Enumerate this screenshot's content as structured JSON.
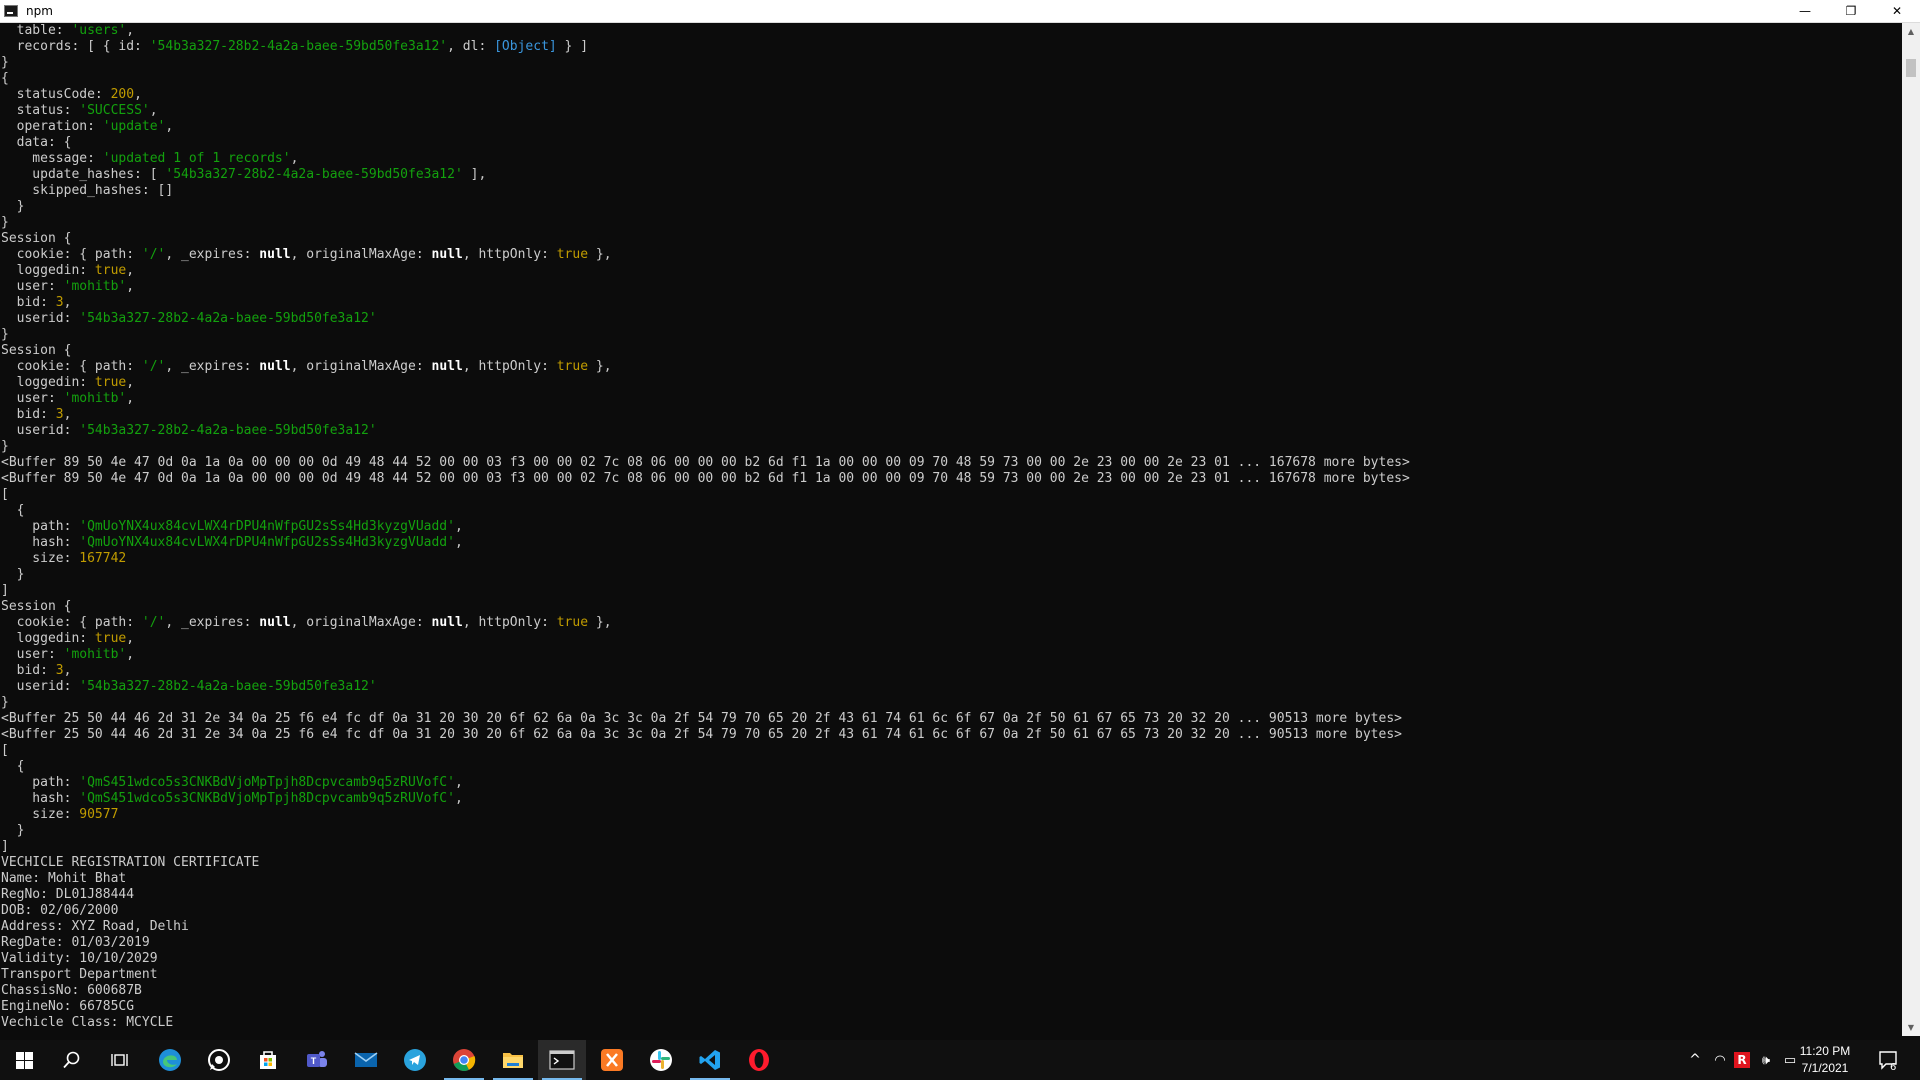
{
  "window": {
    "title": "npm",
    "minimize_glyph": "—",
    "maximize_glyph": "❐",
    "close_glyph": "✕"
  },
  "console": {
    "lines": [
      [
        {
          "t": "  table: "
        },
        {
          "t": "'users'",
          "c": "s"
        },
        {
          "t": ","
        }
      ],
      [
        {
          "t": "  records: [ { id: "
        },
        {
          "t": "'54b3a327-28b2-4a2a-baee-59bd50fe3a12'",
          "c": "s"
        },
        {
          "t": ", dl: "
        },
        {
          "t": "[Object]",
          "c": "c"
        },
        {
          "t": " } ]"
        }
      ],
      [
        {
          "t": "}"
        }
      ],
      [
        {
          "t": "{"
        }
      ],
      [
        {
          "t": "  statusCode: "
        },
        {
          "t": "200",
          "c": "n"
        },
        {
          "t": ","
        }
      ],
      [
        {
          "t": "  status: "
        },
        {
          "t": "'SUCCESS'",
          "c": "s"
        },
        {
          "t": ","
        }
      ],
      [
        {
          "t": "  operation: "
        },
        {
          "t": "'update'",
          "c": "s"
        },
        {
          "t": ","
        }
      ],
      [
        {
          "t": "  data: {"
        }
      ],
      [
        {
          "t": "    message: "
        },
        {
          "t": "'updated 1 of 1 records'",
          "c": "s"
        },
        {
          "t": ","
        }
      ],
      [
        {
          "t": "    update_hashes: [ "
        },
        {
          "t": "'54b3a327-28b2-4a2a-baee-59bd50fe3a12'",
          "c": "s"
        },
        {
          "t": " ],"
        }
      ],
      [
        {
          "t": "    skipped_hashes: []"
        }
      ],
      [
        {
          "t": "  }"
        }
      ],
      [
        {
          "t": "}"
        }
      ],
      [
        {
          "t": "Session {"
        }
      ],
      [
        {
          "t": "  cookie: { path: "
        },
        {
          "t": "'/'",
          "c": "s"
        },
        {
          "t": ", _expires: "
        },
        {
          "t": "null",
          "c": "null"
        },
        {
          "t": ", originalMaxAge: "
        },
        {
          "t": "null",
          "c": "null"
        },
        {
          "t": ", httpOnly: "
        },
        {
          "t": "true",
          "c": "b"
        },
        {
          "t": " },"
        }
      ],
      [
        {
          "t": "  loggedin: "
        },
        {
          "t": "true",
          "c": "b"
        },
        {
          "t": ","
        }
      ],
      [
        {
          "t": "  user: "
        },
        {
          "t": "'mohitb'",
          "c": "s"
        },
        {
          "t": ","
        }
      ],
      [
        {
          "t": "  bid: "
        },
        {
          "t": "3",
          "c": "n"
        },
        {
          "t": ","
        }
      ],
      [
        {
          "t": "  userid: "
        },
        {
          "t": "'54b3a327-28b2-4a2a-baee-59bd50fe3a12'",
          "c": "s"
        }
      ],
      [
        {
          "t": "}"
        }
      ],
      [
        {
          "t": "Session {"
        }
      ],
      [
        {
          "t": "  cookie: { path: "
        },
        {
          "t": "'/'",
          "c": "s"
        },
        {
          "t": ", _expires: "
        },
        {
          "t": "null",
          "c": "null"
        },
        {
          "t": ", originalMaxAge: "
        },
        {
          "t": "null",
          "c": "null"
        },
        {
          "t": ", httpOnly: "
        },
        {
          "t": "true",
          "c": "b"
        },
        {
          "t": " },"
        }
      ],
      [
        {
          "t": "  loggedin: "
        },
        {
          "t": "true",
          "c": "b"
        },
        {
          "t": ","
        }
      ],
      [
        {
          "t": "  user: "
        },
        {
          "t": "'mohitb'",
          "c": "s"
        },
        {
          "t": ","
        }
      ],
      [
        {
          "t": "  bid: "
        },
        {
          "t": "3",
          "c": "n"
        },
        {
          "t": ","
        }
      ],
      [
        {
          "t": "  userid: "
        },
        {
          "t": "'54b3a327-28b2-4a2a-baee-59bd50fe3a12'",
          "c": "s"
        }
      ],
      [
        {
          "t": "}"
        }
      ],
      [
        {
          "t": "<Buffer 89 50 4e 47 0d 0a 1a 0a 00 00 00 0d 49 48 44 52 00 00 03 f3 00 00 02 7c 08 06 00 00 00 b2 6d f1 1a 00 00 00 09 70 48 59 73 00 00 2e 23 00 00 2e 23 01 ... 167678 more bytes>"
        }
      ],
      [
        {
          "t": "<Buffer 89 50 4e 47 0d 0a 1a 0a 00 00 00 0d 49 48 44 52 00 00 03 f3 00 00 02 7c 08 06 00 00 00 b2 6d f1 1a 00 00 00 09 70 48 59 73 00 00 2e 23 00 00 2e 23 01 ... 167678 more bytes>"
        }
      ],
      [
        {
          "t": "["
        }
      ],
      [
        {
          "t": "  {"
        }
      ],
      [
        {
          "t": "    path: "
        },
        {
          "t": "'QmUoYNX4ux84cvLWX4rDPU4nWfpGU2sSs4Hd3kyzgVUadd'",
          "c": "s"
        },
        {
          "t": ","
        }
      ],
      [
        {
          "t": "    hash: "
        },
        {
          "t": "'QmUoYNX4ux84cvLWX4rDPU4nWfpGU2sSs4Hd3kyzgVUadd'",
          "c": "s"
        },
        {
          "t": ","
        }
      ],
      [
        {
          "t": "    size: "
        },
        {
          "t": "167742",
          "c": "n"
        }
      ],
      [
        {
          "t": "  }"
        }
      ],
      [
        {
          "t": "]"
        }
      ],
      [
        {
          "t": "Session {"
        }
      ],
      [
        {
          "t": "  cookie: { path: "
        },
        {
          "t": "'/'",
          "c": "s"
        },
        {
          "t": ", _expires: "
        },
        {
          "t": "null",
          "c": "null"
        },
        {
          "t": ", originalMaxAge: "
        },
        {
          "t": "null",
          "c": "null"
        },
        {
          "t": ", httpOnly: "
        },
        {
          "t": "true",
          "c": "b"
        },
        {
          "t": " },"
        }
      ],
      [
        {
          "t": "  loggedin: "
        },
        {
          "t": "true",
          "c": "b"
        },
        {
          "t": ","
        }
      ],
      [
        {
          "t": "  user: "
        },
        {
          "t": "'mohitb'",
          "c": "s"
        },
        {
          "t": ","
        }
      ],
      [
        {
          "t": "  bid: "
        },
        {
          "t": "3",
          "c": "n"
        },
        {
          "t": ","
        }
      ],
      [
        {
          "t": "  userid: "
        },
        {
          "t": "'54b3a327-28b2-4a2a-baee-59bd50fe3a12'",
          "c": "s"
        }
      ],
      [
        {
          "t": "}"
        }
      ],
      [
        {
          "t": "<Buffer 25 50 44 46 2d 31 2e 34 0a 25 f6 e4 fc df 0a 31 20 30 20 6f 62 6a 0a 3c 3c 0a 2f 54 79 70 65 20 2f 43 61 74 61 6c 6f 67 0a 2f 50 61 67 65 73 20 32 20 ... 90513 more bytes>"
        }
      ],
      [
        {
          "t": "<Buffer 25 50 44 46 2d 31 2e 34 0a 25 f6 e4 fc df 0a 31 20 30 20 6f 62 6a 0a 3c 3c 0a 2f 54 79 70 65 20 2f 43 61 74 61 6c 6f 67 0a 2f 50 61 67 65 73 20 32 20 ... 90513 more bytes>"
        }
      ],
      [
        {
          "t": "["
        }
      ],
      [
        {
          "t": "  {"
        }
      ],
      [
        {
          "t": "    path: "
        },
        {
          "t": "'QmS451wdco5s3CNKBdVjoMpTpjh8Dcpvcamb9q5zRUVofC'",
          "c": "s"
        },
        {
          "t": ","
        }
      ],
      [
        {
          "t": "    hash: "
        },
        {
          "t": "'QmS451wdco5s3CNKBdVjoMpTpjh8Dcpvcamb9q5zRUVofC'",
          "c": "s"
        },
        {
          "t": ","
        }
      ],
      [
        {
          "t": "    size: "
        },
        {
          "t": "90577",
          "c": "n"
        }
      ],
      [
        {
          "t": "  }"
        }
      ],
      [
        {
          "t": "]"
        }
      ],
      [
        {
          "t": "VECHICLE REGISTRATION CERTIFICATE"
        }
      ],
      [
        {
          "t": "Name: Mohit Bhat"
        }
      ],
      [
        {
          "t": "RegNo: DL01J88444"
        }
      ],
      [
        {
          "t": "DOB: 02/06/2000"
        }
      ],
      [
        {
          "t": "Address: XYZ Road, Delhi"
        }
      ],
      [
        {
          "t": "RegDate: 01/03/2019"
        }
      ],
      [
        {
          "t": "Validity: 10/10/2029"
        }
      ],
      [
        {
          "t": "Transport Department"
        }
      ],
      [
        {
          "t": "ChassisNo: 600687B"
        }
      ],
      [
        {
          "t": "EngineNo: 66785CG"
        }
      ],
      [
        {
          "t": "Vechicle Class: MCYCLE"
        }
      ]
    ]
  },
  "scrollbar": {
    "up_glyph": "▲",
    "down_glyph": "▼"
  },
  "colors": {
    "string": "#13a10e",
    "number": "#c19c00",
    "special": "#3a96dd",
    "accent": "#76b9ed"
  },
  "taskbar": {
    "items": [
      {
        "name": "start-windows-icon",
        "interactable": true
      },
      {
        "name": "search-icon",
        "interactable": true
      },
      {
        "name": "task-view-icon",
        "interactable": true
      },
      {
        "name": "edge-browser-icon",
        "interactable": true
      },
      {
        "name": "whatsapp-icon",
        "interactable": true
      },
      {
        "name": "microsoft-store-icon",
        "interactable": true
      },
      {
        "name": "teams-icon",
        "interactable": true
      },
      {
        "name": "mail-icon",
        "interactable": true
      },
      {
        "name": "telegram-icon",
        "interactable": true
      },
      {
        "name": "chrome-icon",
        "interactable": true
      },
      {
        "name": "file-explorer-icon",
        "interactable": true
      },
      {
        "name": "terminal-icon",
        "interactable": true,
        "active": true
      },
      {
        "name": "xampp-icon",
        "interactable": true
      },
      {
        "name": "slack-icon",
        "interactable": true
      },
      {
        "name": "vscode-icon",
        "interactable": true
      },
      {
        "name": "opera-icon",
        "interactable": true
      }
    ],
    "tray": {
      "chevron": "^",
      "wifi": "◠",
      "app_badge": "R",
      "volume": "🕪",
      "battery": "▭"
    },
    "clock": {
      "time": "11:20 PM",
      "date": "7/1/2021"
    },
    "notification_count": "6"
  }
}
